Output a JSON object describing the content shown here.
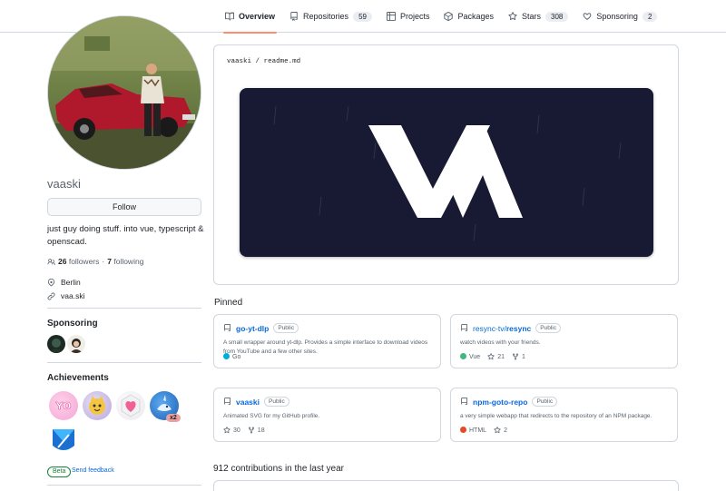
{
  "tabs": [
    {
      "label": "Overview",
      "icon": "book-icon",
      "count": ""
    },
    {
      "label": "Repositories",
      "icon": "repo-icon",
      "count": "59"
    },
    {
      "label": "Projects",
      "icon": "table-icon",
      "count": ""
    },
    {
      "label": "Packages",
      "icon": "package-icon",
      "count": ""
    },
    {
      "label": "Stars",
      "icon": "star-icon",
      "count": "308"
    },
    {
      "label": "Sponsoring",
      "icon": "heart-icon",
      "count": "2"
    }
  ],
  "profile": {
    "username": "vaaski",
    "follow_label": "Follow",
    "bio": "just guy doing stuff. into vue, typescript & openscad.",
    "followers_count": "26",
    "followers_label": "followers",
    "separator": "·",
    "following_count": "7",
    "following_label": "following",
    "location": "Berlin",
    "website": "vaa.ski"
  },
  "sponsoring": {
    "title": "Sponsoring"
  },
  "achievements": {
    "title": "Achievements",
    "multiplier": "x2",
    "beta_label": "Beta",
    "feedback_label": "Send feedback"
  },
  "readme": {
    "owner": "vaaski",
    "slash": "/",
    "file": "readme.md"
  },
  "pinned": {
    "title": "Pinned",
    "repos": [
      {
        "owner": "",
        "name": "go-yt-dlp",
        "visibility": "Public",
        "description": "A small wrapper around yt-dlp. Provides a simple interface to download videos from YouTube and a few other sites.",
        "language": "Go",
        "lang_color": "#00add8",
        "stars": "",
        "forks": ""
      },
      {
        "owner": "resync-tv/",
        "name": "resync",
        "visibility": "Public",
        "description": "watch videos with your friends.",
        "language": "Vue",
        "lang_color": "#41b883",
        "stars": "21",
        "forks": "1"
      },
      {
        "owner": "",
        "name": "vaaski",
        "visibility": "Public",
        "description": "Animated SVG for my GitHub profile.",
        "language": "",
        "lang_color": "",
        "stars": "30",
        "forks": "18"
      },
      {
        "owner": "",
        "name": "npm-goto-repo",
        "visibility": "Public",
        "description": "a very simple webapp that redirects to the repository of an NPM package.",
        "language": "HTML",
        "lang_color": "#e34c26",
        "stars": "2",
        "forks": ""
      }
    ]
  },
  "contributions": {
    "title": "912 contributions in the last year"
  },
  "colors": {
    "accent": "#fd8c73",
    "link": "#0969da",
    "banner": "#181a33"
  }
}
